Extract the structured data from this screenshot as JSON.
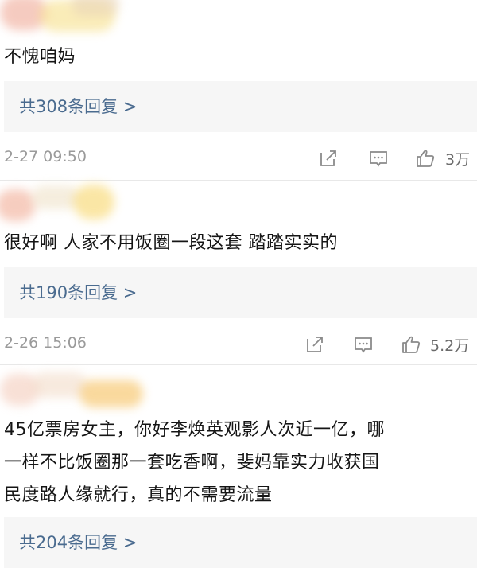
{
  "comments": [
    {
      "text": "不愧咱妈",
      "reply_link": "共308条回复 >",
      "time": "2-27 09:50",
      "likes": "3万"
    },
    {
      "text": "很好啊 人家不用饭圈一段这套 踏踏实实的",
      "reply_link": "共190条回复 >",
      "time": "2-26 15:06",
      "likes": "5.2万"
    },
    {
      "text_lines": [
        "45亿票房女主，你好李焕英观影人次近一亿，哪",
        "一样不比饭圈那一套吃香啊，斐妈靠实力收获国",
        "民度路人缘就行，真的不需要流量"
      ],
      "reply_link": "共204条回复 >"
    }
  ],
  "icons": {
    "share": "share-icon",
    "comment": "comment-icon",
    "like": "thumbs-up-icon"
  },
  "colors": {
    "link": "#4a6b8f",
    "reply_bg": "#f6f6f6",
    "meta": "#9a9a9a"
  }
}
